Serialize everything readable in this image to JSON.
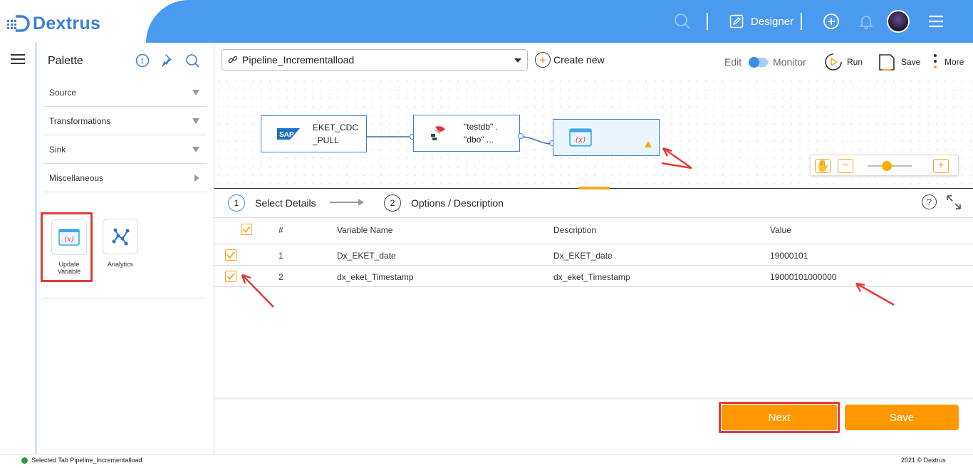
{
  "app": {
    "name": "Dextrus"
  },
  "header": {
    "designer_label": "Designer"
  },
  "palette": {
    "title": "Palette",
    "sections": [
      {
        "label": "Source",
        "expander": "down"
      },
      {
        "label": "Transformations",
        "expander": "down"
      },
      {
        "label": "Sink",
        "expander": "down"
      },
      {
        "label": "Miscellaneous",
        "expander": "right"
      }
    ],
    "tiles": [
      {
        "label": "Update Variable",
        "icon": "variable-icon"
      },
      {
        "label": "Analytics",
        "icon": "analytics-icon"
      }
    ]
  },
  "toolbar": {
    "pipeline_selected": "Pipeline_Incrementalload",
    "create_new": "Create new",
    "edit_label": "Edit",
    "monitor_label": "Monitor",
    "run_label": "Run",
    "save_label": "Save",
    "more_label": "More"
  },
  "canvas": {
    "nodes": [
      {
        "name": "sap-node",
        "line1": "EKET_CDC",
        "line2": "_PULL"
      },
      {
        "name": "db-node",
        "line1": "\"testdb\" .",
        "line2": "\"dbo\" ..."
      },
      {
        "name": "update-variable-node",
        "line1": "",
        "line2": ""
      }
    ]
  },
  "steps": [
    {
      "number": "1",
      "label": "Select Details"
    },
    {
      "number": "2",
      "label": "Options / Description"
    }
  ],
  "table": {
    "columns": [
      "#",
      "Variable Name",
      "Description",
      "Value"
    ],
    "rows": [
      {
        "num": "1",
        "name": "Dx_EKET_date",
        "description": "Dx_EKET_date",
        "value": "19000101"
      },
      {
        "num": "2",
        "name": "dx_eket_Timestamp",
        "description": "dx_eket_Timestamp",
        "value": "19000101000000"
      }
    ]
  },
  "buttons": {
    "next": "Next",
    "save": "Save"
  },
  "status": {
    "left": "Selected Tab Pipeline_Incrementalload",
    "right": "2021 © Dextrus"
  },
  "colors": {
    "brand_blue": "#4a9af0",
    "accent_orange": "#ff9800",
    "annotation_red": "#e23b3b",
    "node_border": "#3d7fd6"
  }
}
